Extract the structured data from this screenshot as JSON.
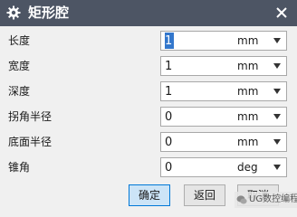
{
  "window": {
    "title": "矩形腔",
    "title_icon": "gear-icon",
    "close_icon": "close-icon",
    "colors": {
      "titlebar": "#4d5564",
      "primary_button": "#cce4f7",
      "focus": "#3377cc"
    }
  },
  "fields": [
    {
      "label": "长度",
      "value": "1",
      "unit": "mm"
    },
    {
      "label": "宽度",
      "value": "1",
      "unit": "mm"
    },
    {
      "label": "深度",
      "value": "1",
      "unit": "mm"
    },
    {
      "label": "拐角半径",
      "value": "0",
      "unit": "mm"
    },
    {
      "label": "底面半径",
      "value": "0",
      "unit": "mm"
    },
    {
      "label": "锥角",
      "value": "0",
      "unit": "deg"
    }
  ],
  "buttons": {
    "ok": "确定",
    "back": "返回",
    "cancel": "取消"
  },
  "watermark": {
    "text": "UG数控编程"
  }
}
